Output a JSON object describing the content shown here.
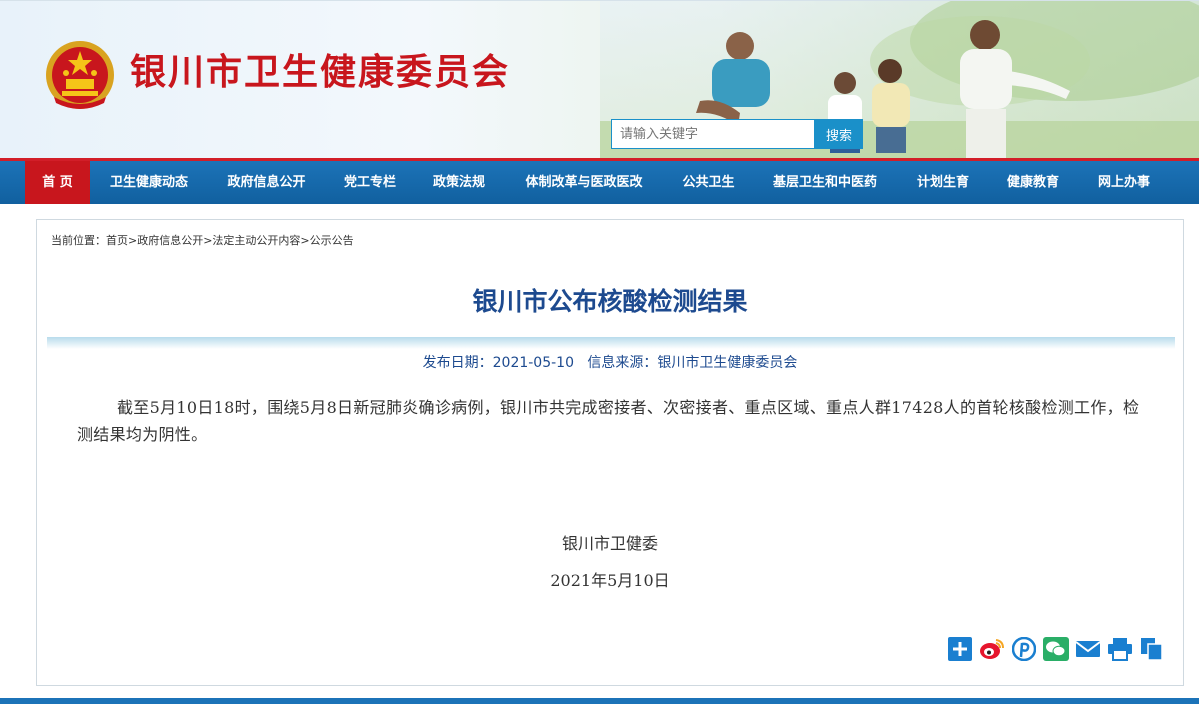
{
  "header": {
    "site_title": "银川市卫生健康委员会",
    "search_placeholder": "请输入关键字",
    "search_button": "搜索"
  },
  "nav": {
    "items": [
      {
        "label": "首 页",
        "active": true
      },
      {
        "label": "卫生健康动态"
      },
      {
        "label": "政府信息公开"
      },
      {
        "label": "党工专栏"
      },
      {
        "label": "政策法规"
      },
      {
        "label": "体制改革与医政医改"
      },
      {
        "label": "公共卫生"
      },
      {
        "label": "基层卫生和中医药"
      },
      {
        "label": "计划生育"
      },
      {
        "label": "健康教育"
      },
      {
        "label": "网上办事"
      }
    ]
  },
  "breadcrumb": {
    "prefix": "当前位置：",
    "path": "首页>政府信息公开>法定主动公开内容>公示公告"
  },
  "article": {
    "title": "银川市公布核酸检测结果",
    "publish_label": "发布日期：",
    "publish_date": "2021-05-10",
    "source_label": "信息来源：",
    "source": "银川市卫生健康委员会",
    "body": "截至5月10日18时，围绕5月8日新冠肺炎确诊病例，银川市共完成密接者、次密接者、重点区域、重点人群17428人的首轮核酸检测工作，检测结果均为阴性。",
    "signature": "银川市卫健委",
    "sign_date": "2021年5月10日"
  },
  "share_icons": [
    "plus-icon",
    "weibo-icon",
    "pinterest-icon",
    "wechat-icon",
    "mail-icon",
    "print-icon",
    "copy-icon"
  ],
  "colors": {
    "brand_red": "#c8161d",
    "nav_blue": "#1c73b8",
    "title_blue": "#1d4a8f",
    "search_blue": "#1a90c9",
    "share_blue": "#1a7fd0"
  }
}
